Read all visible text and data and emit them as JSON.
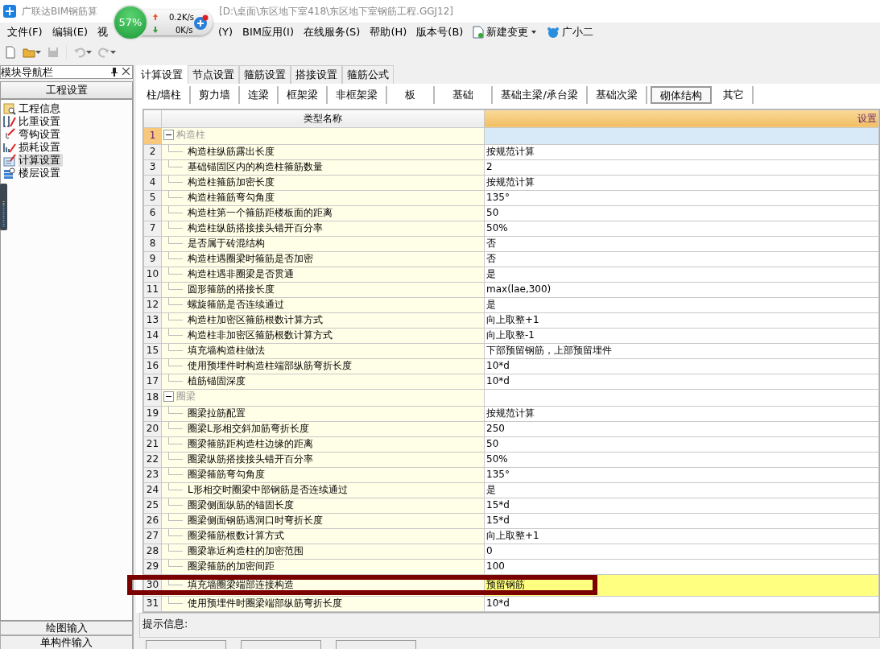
{
  "window": {
    "title_left": "广联达BIM钢筋算",
    "title_right": "[D:\\桌面\\东区地下室418\\东区地下室钢筋工程.GGJ12]"
  },
  "net_widget": {
    "percent": "57%",
    "up": "0.2K/s",
    "down": "0K/s"
  },
  "menu": [
    {
      "label": "文件(F)",
      "kind": "plain"
    },
    {
      "label": "编辑(E)",
      "kind": "plain"
    },
    {
      "label": "视",
      "kind": "plain"
    },
    {
      "label": "(Y)",
      "kind": "after-widget"
    },
    {
      "label": "BIM应用(I)",
      "kind": "plain"
    },
    {
      "label": "在线服务(S)",
      "kind": "plain"
    },
    {
      "label": "帮助(H)",
      "kind": "plain"
    },
    {
      "label": "版本号(B)",
      "kind": "plain"
    },
    {
      "label": "新建变更",
      "kind": "doc-dropdown"
    },
    {
      "label": "广小二",
      "kind": "assistant"
    }
  ],
  "sidebar": {
    "title": "模块导航栏",
    "section": "工程设置",
    "items": [
      {
        "label": "工程信息",
        "selected": false
      },
      {
        "label": "比重设置",
        "selected": false
      },
      {
        "label": "弯钩设置",
        "selected": false
      },
      {
        "label": "损耗设置",
        "selected": false
      },
      {
        "label": "计算设置",
        "selected": true
      },
      {
        "label": "楼层设置",
        "selected": false
      }
    ],
    "bottom_buttons": [
      "绘图输入",
      "单构件输入"
    ]
  },
  "tabs": [
    {
      "label": "计算设置",
      "selected": true
    },
    {
      "label": "节点设置",
      "selected": false
    },
    {
      "label": "箍筋设置",
      "selected": false
    },
    {
      "label": "搭接设置",
      "selected": false
    },
    {
      "label": "箍筋公式",
      "selected": false
    }
  ],
  "subtabs": [
    {
      "label": "柱/墙柱",
      "selected": false
    },
    {
      "label": "剪力墙",
      "selected": false
    },
    {
      "label": "连梁",
      "selected": false
    },
    {
      "label": "框架梁",
      "selected": false
    },
    {
      "label": "非框架梁",
      "selected": false
    },
    {
      "label": "板",
      "selected": false
    },
    {
      "label": "基础",
      "selected": false
    },
    {
      "label": "基础主梁/承台梁",
      "selected": false
    },
    {
      "label": "基础次梁",
      "selected": false
    },
    {
      "label": "砌体结构",
      "selected": true
    },
    {
      "label": "其它",
      "selected": false
    }
  ],
  "table": {
    "columns": [
      "类型名称",
      "设置"
    ],
    "rows": [
      {
        "no": "1",
        "kind": "group",
        "name": "构造柱",
        "value": "",
        "selected": true,
        "highlighted": false
      },
      {
        "no": "2",
        "kind": "item",
        "name": "构造柱纵筋露出长度",
        "value": "按规范计算",
        "selected": false,
        "highlighted": false
      },
      {
        "no": "3",
        "kind": "item",
        "name": "基础锚固区内的构造柱箍筋数量",
        "value": "2",
        "selected": false,
        "highlighted": false
      },
      {
        "no": "4",
        "kind": "item",
        "name": "构造柱箍筋加密长度",
        "value": "按规范计算",
        "selected": false,
        "highlighted": false
      },
      {
        "no": "5",
        "kind": "item",
        "name": "构造柱箍筋弯勾角度",
        "value": "135°",
        "selected": false,
        "highlighted": false
      },
      {
        "no": "6",
        "kind": "item",
        "name": "构造柱第一个箍筋距楼板面的距离",
        "value": "50",
        "selected": false,
        "highlighted": false
      },
      {
        "no": "7",
        "kind": "item",
        "name": "构造柱纵筋搭接接头错开百分率",
        "value": "50%",
        "selected": false,
        "highlighted": false
      },
      {
        "no": "8",
        "kind": "item",
        "name": "是否属于砖混结构",
        "value": "否",
        "selected": false,
        "highlighted": false
      },
      {
        "no": "9",
        "kind": "item",
        "name": "构造柱遇圈梁时箍筋是否加密",
        "value": "否",
        "selected": false,
        "highlighted": false
      },
      {
        "no": "10",
        "kind": "item",
        "name": "构造柱遇非圈梁是否贯通",
        "value": "是",
        "selected": false,
        "highlighted": false
      },
      {
        "no": "11",
        "kind": "item",
        "name": "圆形箍筋的搭接长度",
        "value": "max(lae,300)",
        "selected": false,
        "highlighted": false
      },
      {
        "no": "12",
        "kind": "item",
        "name": "螺旋箍筋是否连续通过",
        "value": "是",
        "selected": false,
        "highlighted": false
      },
      {
        "no": "13",
        "kind": "item",
        "name": "构造柱加密区箍筋根数计算方式",
        "value": "向上取整+1",
        "selected": false,
        "highlighted": false
      },
      {
        "no": "14",
        "kind": "item",
        "name": "构造柱非加密区箍筋根数计算方式",
        "value": "向上取整-1",
        "selected": false,
        "highlighted": false
      },
      {
        "no": "15",
        "kind": "item",
        "name": "填充墙构造柱做法",
        "value": "下部预留钢筋，上部预留埋件",
        "selected": false,
        "highlighted": false
      },
      {
        "no": "16",
        "kind": "item",
        "name": "使用预埋件时构造柱端部纵筋弯折长度",
        "value": "10*d",
        "selected": false,
        "highlighted": false
      },
      {
        "no": "17",
        "kind": "last",
        "name": "植筋锚固深度",
        "value": "10*d",
        "selected": false,
        "highlighted": false
      },
      {
        "no": "18",
        "kind": "group",
        "name": "圈梁",
        "value": "",
        "selected": false,
        "highlighted": false
      },
      {
        "no": "19",
        "kind": "item",
        "name": "圈梁拉筋配置",
        "value": "按规范计算",
        "selected": false,
        "highlighted": false
      },
      {
        "no": "20",
        "kind": "item",
        "name": "圈梁L形相交斜加筋弯折长度",
        "value": "250",
        "selected": false,
        "highlighted": false
      },
      {
        "no": "21",
        "kind": "item",
        "name": "圈梁箍筋距构造柱边缘的距离",
        "value": "50",
        "selected": false,
        "highlighted": false
      },
      {
        "no": "22",
        "kind": "item",
        "name": "圈梁纵筋搭接接头错开百分率",
        "value": "50%",
        "selected": false,
        "highlighted": false
      },
      {
        "no": "23",
        "kind": "item",
        "name": "圈梁箍筋弯勾角度",
        "value": "135°",
        "selected": false,
        "highlighted": false
      },
      {
        "no": "24",
        "kind": "item",
        "name": "L形相交时圈梁中部钢筋是否连续通过",
        "value": "是",
        "selected": false,
        "highlighted": false
      },
      {
        "no": "25",
        "kind": "item",
        "name": "圈梁侧面纵筋的锚固长度",
        "value": "15*d",
        "selected": false,
        "highlighted": false
      },
      {
        "no": "26",
        "kind": "item",
        "name": "圈梁侧面钢筋遇洞口时弯折长度",
        "value": "15*d",
        "selected": false,
        "highlighted": false
      },
      {
        "no": "27",
        "kind": "item",
        "name": "圈梁箍筋根数计算方式",
        "value": "向上取整+1",
        "selected": false,
        "highlighted": false
      },
      {
        "no": "28",
        "kind": "item",
        "name": "圈梁靠近构造柱的加密范围",
        "value": "0",
        "selected": false,
        "highlighted": false
      },
      {
        "no": "29",
        "kind": "item",
        "name": "圈梁箍筋的加密间距",
        "value": "100",
        "selected": false,
        "highlighted": false
      },
      {
        "no": "30",
        "kind": "item",
        "name": "填充墙圈梁端部连接构造",
        "value": "预留钢筋",
        "selected": false,
        "highlighted": true
      },
      {
        "no": "31",
        "kind": "item",
        "name": "使用预埋件时圈梁端部纵筋弯折长度",
        "value": "10*d",
        "selected": false,
        "highlighted": false
      }
    ]
  },
  "annotation": {
    "kind": "frame",
    "color": "#7b0000"
  },
  "hint": {
    "label": "提示信息:"
  }
}
